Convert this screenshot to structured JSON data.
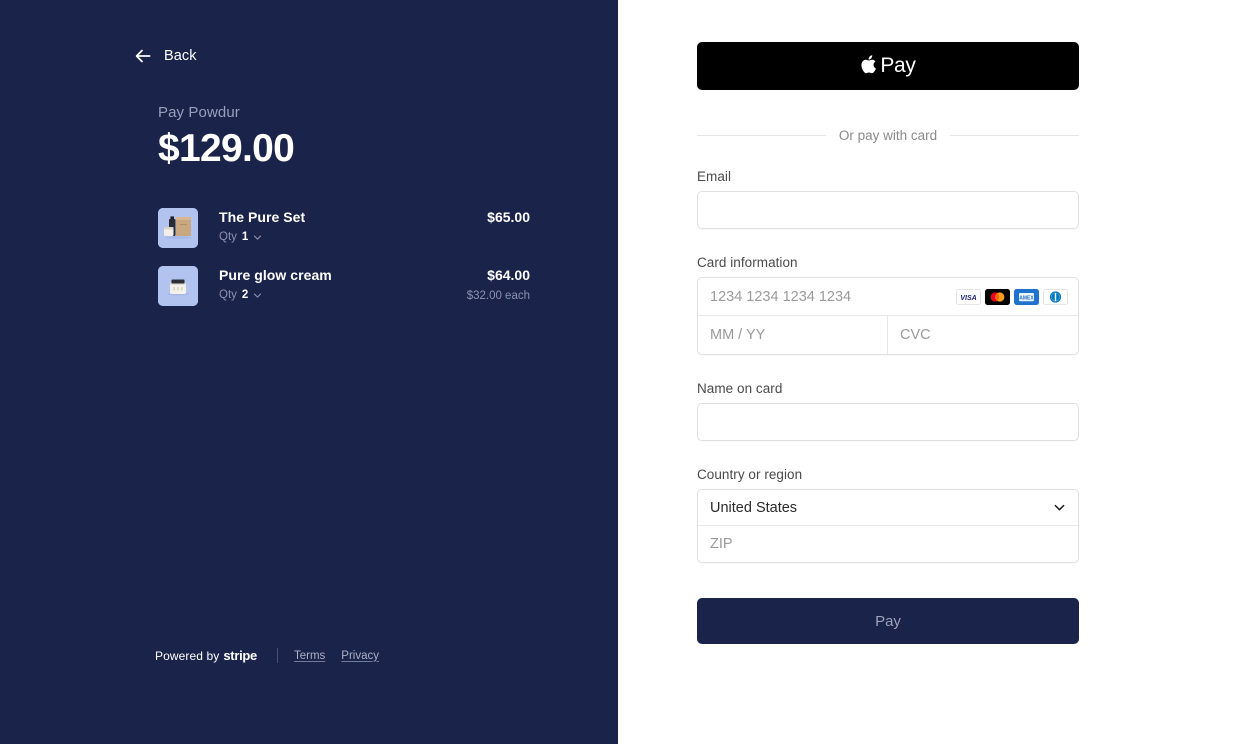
{
  "colors": {
    "navy": "#1a2349",
    "panel_white": "#ffffff",
    "muted_navy_text": "#98a0bd",
    "apple_pay_bg": "#000000",
    "thumb_bg": "#b3c3f0",
    "pay_button_text": "#9aa2bd"
  },
  "left": {
    "back": {
      "label": "Back",
      "icon": "arrow-left-icon"
    },
    "merchant_line": "Pay Powdur",
    "total": "$129.00",
    "items": [
      {
        "name": "The Pure Set",
        "qty_label": "Qty",
        "qty_value": "1",
        "price": "$65.00",
        "each": "",
        "thumb": "product-box-bottle-jar-thumbnail"
      },
      {
        "name": "Pure glow cream",
        "qty_label": "Qty",
        "qty_value": "2",
        "price": "$64.00",
        "each": "$32.00 each",
        "thumb": "product-cream-jar-thumbnail"
      }
    ],
    "footer": {
      "powered_by": "Powered by",
      "brand": "stripe",
      "links": [
        "Terms",
        "Privacy"
      ]
    }
  },
  "right": {
    "apple_pay": {
      "icon": "apple-logo-icon",
      "label": "Pay"
    },
    "divider_text": "Or pay with card",
    "email": {
      "label": "Email",
      "value": "",
      "placeholder": ""
    },
    "card": {
      "label": "Card information",
      "number_placeholder": "1234 1234 1234 1234",
      "number_value": "",
      "expiry_placeholder": "MM / YY",
      "expiry_value": "",
      "cvc_placeholder": "CVC",
      "cvc_value": "",
      "brands": [
        "visa-icon",
        "mastercard-icon",
        "amex-icon",
        "diners-club-icon"
      ]
    },
    "name_on_card": {
      "label": "Name on card",
      "value": "",
      "placeholder": ""
    },
    "country": {
      "label": "Country or region",
      "selected": "United States",
      "chevron": "chevron-down-icon",
      "zip_placeholder": "ZIP",
      "zip_value": ""
    },
    "pay_button": {
      "label": "Pay"
    }
  }
}
